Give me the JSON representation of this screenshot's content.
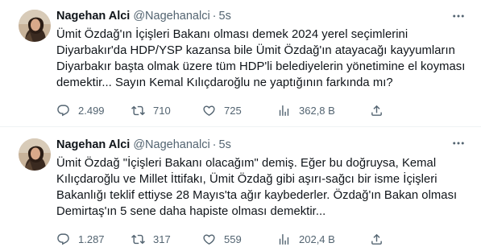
{
  "tweets": [
    {
      "author_name": "Nagehan Alci",
      "handle": "@Nagehanalci",
      "separator": "·",
      "time": "5s",
      "text": "Ümit Özdağ'ın İçişleri Bakanı olması demek 2024 yerel seçimlerini Diyarbakır'da HDP/YSP kazansa bile Ümit Özdağ'ın atayacağı kayyumların Diyarbakır başta olmak üzere tüm HDP'li belediyelerin yönetimine el koyması demektir... Sayın Kemal Kılıçdaroğlu ne yaptığının farkında mı?",
      "stats": {
        "replies": "2.499",
        "retweets": "710",
        "likes": "725",
        "views": "362,8 B"
      }
    },
    {
      "author_name": "Nagehan Alci",
      "handle": "@Nagehanalci",
      "separator": "·",
      "time": "5s",
      "text": "Ümit Özdağ \"İçişleri Bakanı olacağım\" demiş. Eğer bu doğruysa, Kemal Kılıçdaroğlu ve Millet İttifakı, Ümit Özdağ gibi aşırı-sağcı bir isme İçişleri Bakanlığı teklif ettiyse 28 Mayıs'ta ağır kaybederler. Özdağ'ın Bakan olması Demirtaş'ın 5 sene daha hapiste olması demektir...",
      "stats": {
        "replies": "1.287",
        "retweets": "317",
        "likes": "559",
        "views": "202,4 B"
      }
    }
  ],
  "icons": {
    "more": "more-dots-icon",
    "reply": "reply-icon",
    "retweet": "retweet-icon",
    "like": "heart-icon",
    "views": "views-chart-icon",
    "share": "share-icon"
  },
  "colors": {
    "text": "#0f1419",
    "secondary": "#536471",
    "divider": "#eff3f4"
  }
}
